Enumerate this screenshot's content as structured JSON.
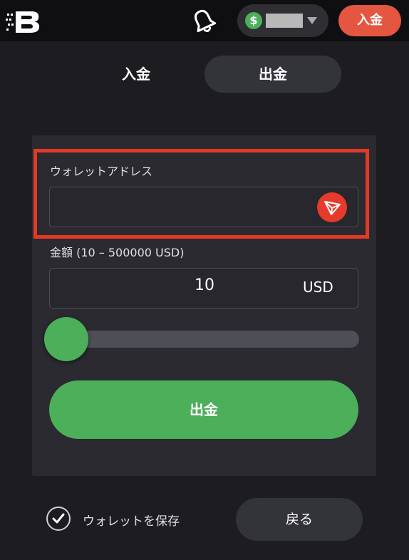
{
  "header": {
    "logo_icon": "brand-logo-icon",
    "bell_icon": "bell-icon",
    "currency_icon": "dollar-icon",
    "currency_symbol": "$",
    "deposit_button": "入金"
  },
  "tabs": [
    {
      "label": "入金",
      "active": false
    },
    {
      "label": "出金",
      "active": true
    }
  ],
  "form": {
    "wallet_address_label": "ウォレットアドレス",
    "wallet_address_value": "",
    "network_icon": "tron-icon",
    "amount_label": "金額 (10 – 500000 USD)",
    "amount_value": "10",
    "amount_unit": "USD",
    "slider": {
      "min": 10,
      "max": 500000,
      "value": 10
    },
    "submit_label": "出金"
  },
  "footer": {
    "save_wallet_label": "ウォレットを保存",
    "save_wallet_checked": true,
    "back_button": "戻る"
  },
  "colors": {
    "accent_green": "#4caf5a",
    "accent_red": "#e4563f",
    "highlight_red": "#e23a26",
    "background": "#1d1d21"
  }
}
